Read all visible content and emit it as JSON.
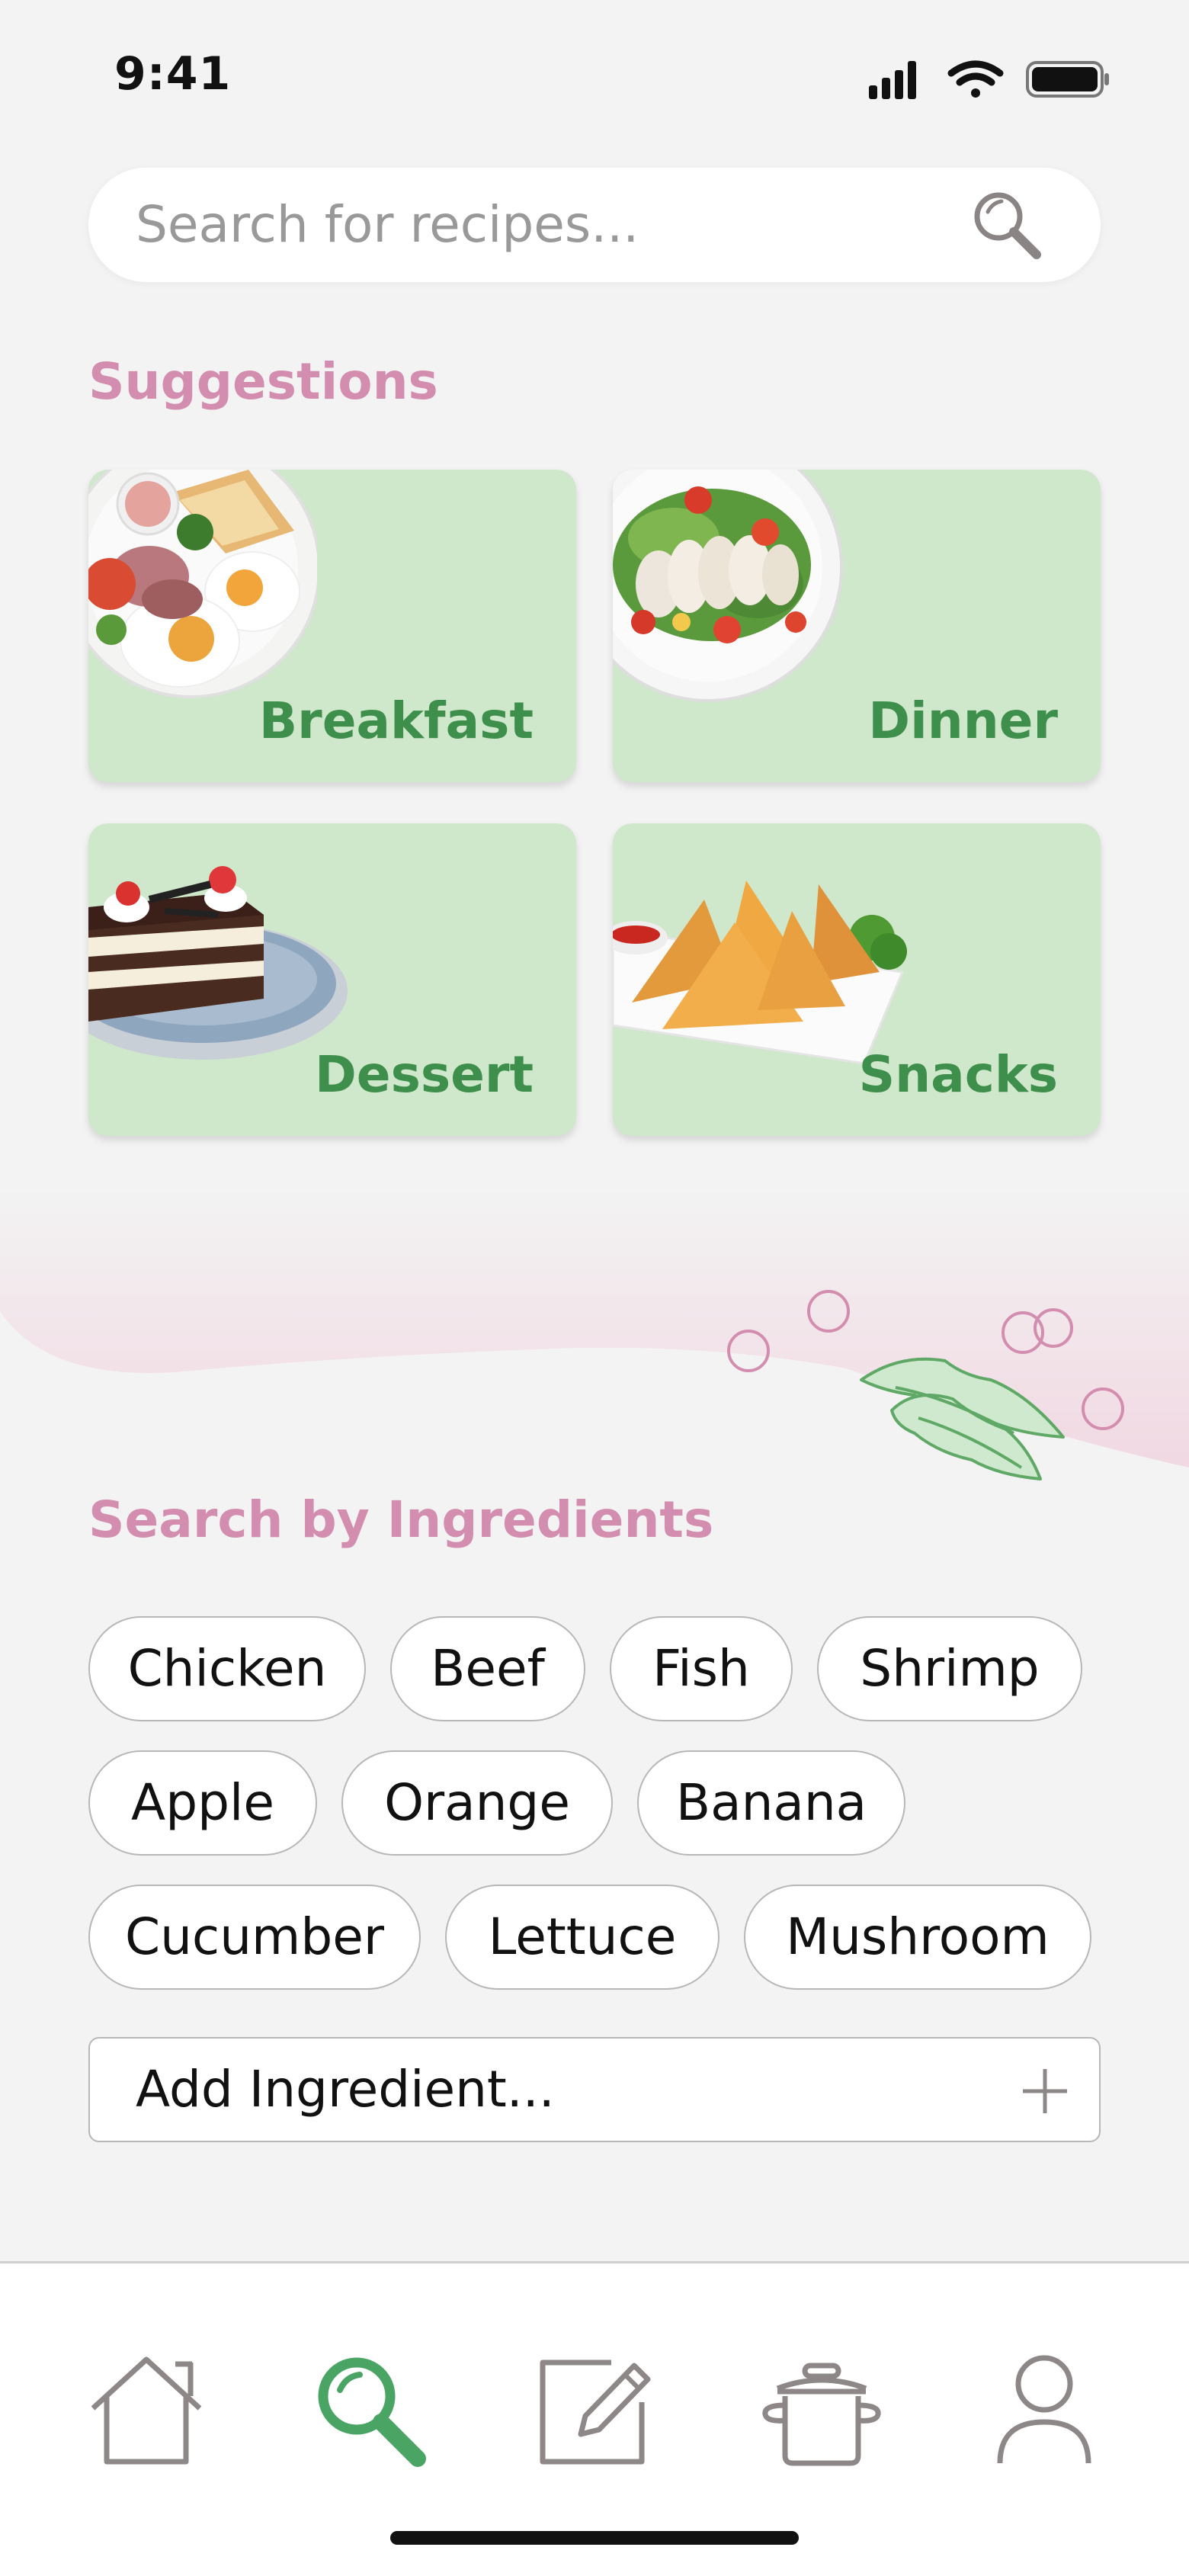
{
  "status_bar": {
    "time": "9:41"
  },
  "search": {
    "placeholder": "Search for recipes..."
  },
  "suggestions": {
    "title": "Suggestions",
    "cards": [
      {
        "label": "Breakfast",
        "image": "breakfast-plate"
      },
      {
        "label": "Dinner",
        "image": "chicken-salad"
      },
      {
        "label": "Dessert",
        "image": "cake-slice"
      },
      {
        "label": "Snacks",
        "image": "samosas"
      }
    ]
  },
  "ingredients": {
    "title": "Search by Ingredients",
    "chips": [
      "Chicken",
      "Beef",
      "Fish",
      "Shrimp",
      "Apple",
      "Orange",
      "Banana",
      "Cucumber",
      "Lettuce",
      "Mushroom"
    ],
    "add_placeholder": "Add Ingredient..."
  },
  "tab_bar": {
    "active": "search",
    "items": [
      "home-icon",
      "search-icon",
      "edit-icon",
      "pot-icon",
      "profile-icon"
    ]
  },
  "colors": {
    "accent_pink": "#d38eaf",
    "card_green": "#cfe7cb",
    "label_green": "#3f8f4c",
    "active_tab": "#4aa564",
    "inactive_tab": "#8e8787"
  }
}
